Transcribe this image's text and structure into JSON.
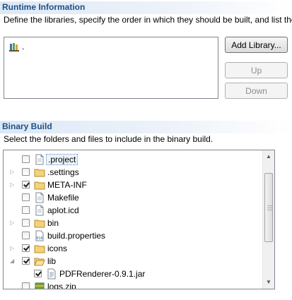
{
  "runtime": {
    "title": "Runtime Information",
    "description": "Define the libraries, specify the order in which they should be built, and list the",
    "library_item": ".",
    "add_library_label": "Add Library...",
    "up_label": "Up",
    "down_label": "Down"
  },
  "binary_build": {
    "title": "Binary Build",
    "description": "Select the folders and files to include in the binary build.",
    "items": [
      {
        "label": ".project",
        "checked": false,
        "icon": "file-icon",
        "twisty": "",
        "indent": 0,
        "selected": true
      },
      {
        "label": ".settings",
        "checked": false,
        "icon": "folder-icon",
        "twisty": "▷",
        "indent": 0
      },
      {
        "label": "META-INF",
        "checked": true,
        "icon": "folder-icon",
        "twisty": "▷",
        "indent": 0
      },
      {
        "label": "Makefile",
        "checked": false,
        "icon": "file-icon",
        "twisty": "",
        "indent": 0
      },
      {
        "label": "aplot.icd",
        "checked": false,
        "icon": "file-icon",
        "twisty": "",
        "indent": 0
      },
      {
        "label": "bin",
        "checked": false,
        "icon": "folder-icon",
        "twisty": "▷",
        "indent": 0
      },
      {
        "label": "build.properties",
        "checked": false,
        "icon": "properties-file-icon",
        "twisty": "",
        "indent": 0
      },
      {
        "label": "icons",
        "checked": true,
        "icon": "folder-icon",
        "twisty": "▷",
        "indent": 0
      },
      {
        "label": "lib",
        "checked": true,
        "icon": "folder-open-icon",
        "twisty": "◢",
        "indent": 0
      },
      {
        "label": "PDFRenderer-0.9.1.jar",
        "checked": true,
        "icon": "jar-file-icon",
        "twisty": "",
        "indent": 1
      },
      {
        "label": "logs.zip",
        "checked": false,
        "icon": "zip-file-icon",
        "twisty": "",
        "indent": 0
      }
    ]
  },
  "colors": {
    "section_title": "#1e4f86",
    "folder": "#e8c15a",
    "check": "#1d1d1d"
  }
}
